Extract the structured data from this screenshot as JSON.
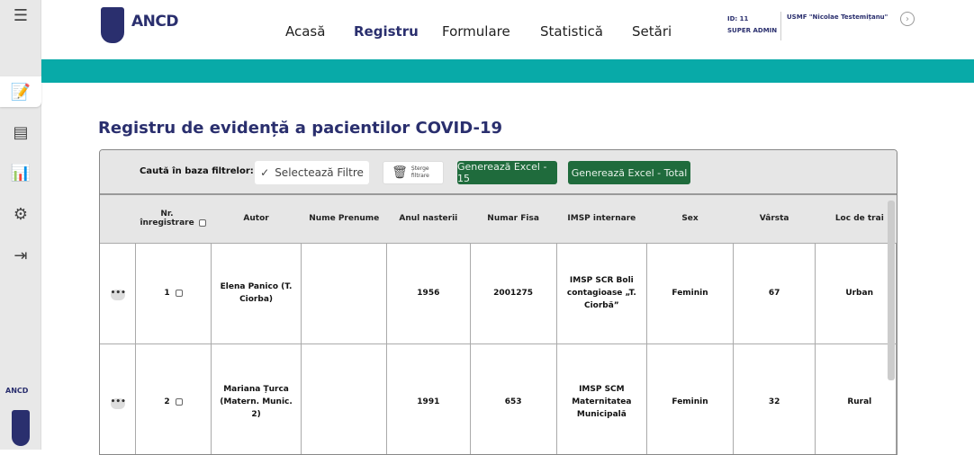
{
  "header": {
    "logo_text": "ANCD",
    "nav": [
      "Acasă",
      "Registru",
      "Formulare",
      "Statistică",
      "Setări"
    ],
    "active_nav": "Registru",
    "user_id": "ID: 11",
    "user_role": "SUPER ADMIN",
    "organization": "USMF \"Nicolae Testemițanu\""
  },
  "sidebar": {
    "icons": [
      "menu-icon",
      "registry-icon",
      "forms-icon",
      "statistics-icon",
      "settings-icon",
      "logout-icon"
    ],
    "logo_text": "ANCD"
  },
  "page": {
    "title": "Registru de evidență a pacientilor COVID-19"
  },
  "filters": {
    "label": "Caută în baza filtrelor:",
    "select": "Selectează Filtre",
    "clear": "Șterge filtrare",
    "excel_page": "Generează Excel - 15",
    "excel_total": "Generează Excel - Total"
  },
  "colors": {
    "accent": "#08aaa8",
    "brand": "#2a2f6e",
    "excel": "#1f6b3c"
  },
  "table": {
    "columns": [
      "Nr. înregistrare",
      "Autor",
      "Nume Prenume",
      "Anul nasterii",
      "Numar Fisa",
      "IMSP internare",
      "Sex",
      "Vârsta",
      "Loc de trai"
    ],
    "rows": [
      {
        "nr": "1",
        "autor": "Elena Panico (T. Ciorba)",
        "nume": "",
        "anul": "1956",
        "fisa": "2001275",
        "imsp": "IMSP SCR Boli contagioase „T. Ciorbă”",
        "sex": "Feminin",
        "varsta": "67",
        "loc": "Urban"
      },
      {
        "nr": "2",
        "autor": "Mariana Țurca (Matern. Munic. 2)",
        "nume": "",
        "anul": "1991",
        "fisa": "653",
        "imsp": "IMSP SCM Maternitatea Municipală",
        "sex": "Feminin",
        "varsta": "32",
        "loc": "Rural"
      }
    ]
  }
}
